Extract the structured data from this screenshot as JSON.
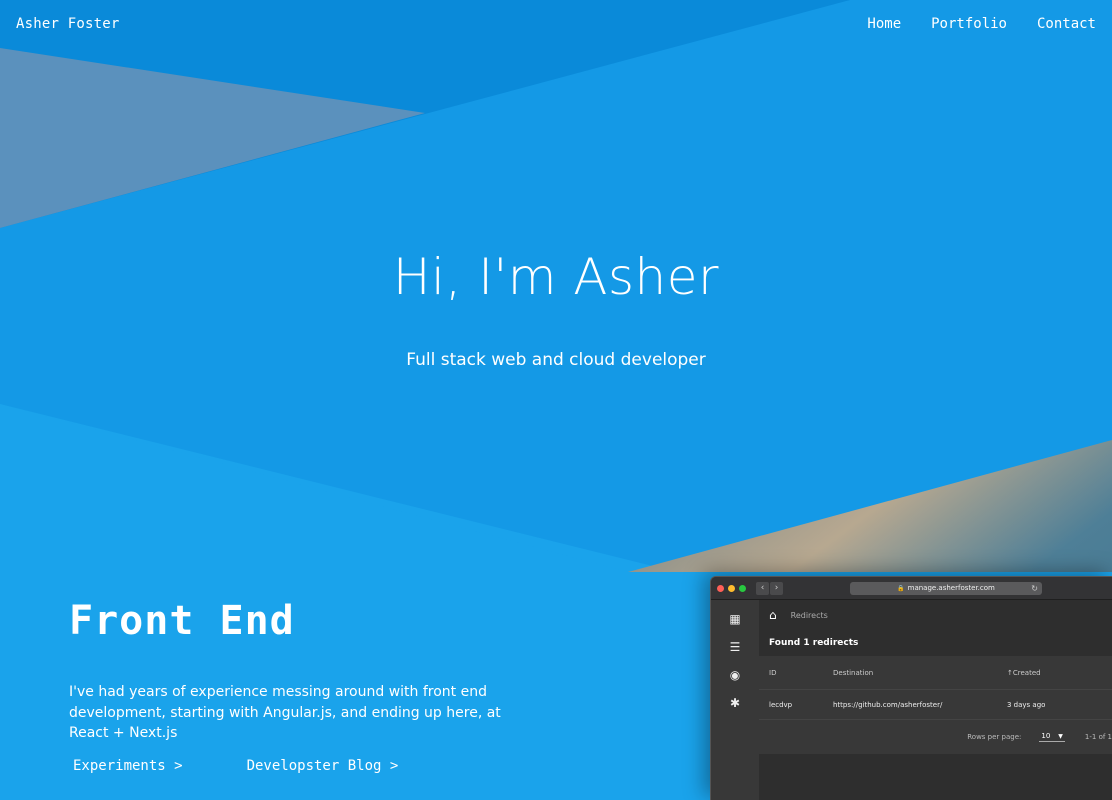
{
  "nav": {
    "brand": "Asher Foster",
    "links": [
      "Home",
      "Portfolio",
      "Contact"
    ]
  },
  "hero": {
    "title": "Hi, I'm Asher",
    "subtitle": "Full stack web and cloud developer"
  },
  "front_end": {
    "title": "Front End",
    "description": "I've had years of experience messing around with front end development, starting with Angular.js, and ending up here, at React + Next.js",
    "links": [
      "Experiments >",
      "Developster Blog >"
    ]
  },
  "mockup": {
    "url": "manage.asherfoster.com",
    "breadcrumb": "Redirects",
    "found_text": "Found 1 redirects",
    "columns": [
      "ID",
      "Destination",
      "Created"
    ],
    "row": {
      "id": "lecdvp",
      "destination": "https://github.com/asherfoster/",
      "created": "3 days ago"
    },
    "rows_per_page_label": "Rows per page:",
    "rows_per_page_value": "10",
    "pagination": "1-1 of 1"
  },
  "colors": {
    "background": "#1499e6",
    "dark_band": "#0a88dc",
    "light_band": "#1ba4ec"
  }
}
